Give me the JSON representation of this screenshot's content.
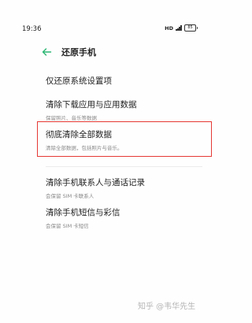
{
  "status_bar": {
    "time": "19:36",
    "network_label": "HD",
    "battery_level": "85"
  },
  "header": {
    "back_icon": "arrow-left-icon",
    "title": "还原手机",
    "accent_color": "#2bb673"
  },
  "options": [
    {
      "title": "仅还原系统设置项",
      "desc": ""
    },
    {
      "title": "清除下载应用与应用数据",
      "desc": "保留照片、音乐等数据"
    },
    {
      "title": "彻底清除全部数据",
      "desc": "清除全部数据，包括照片与音乐。"
    },
    {
      "title": "清除手机联系人与通话记录",
      "desc": "会保留 SIM 卡联系人"
    },
    {
      "title": "清除手机短信与彩信",
      "desc": "会保留 SIM 卡短信"
    }
  ],
  "highlight_color": "#e53935",
  "watermark": "知乎 @韦华先生"
}
